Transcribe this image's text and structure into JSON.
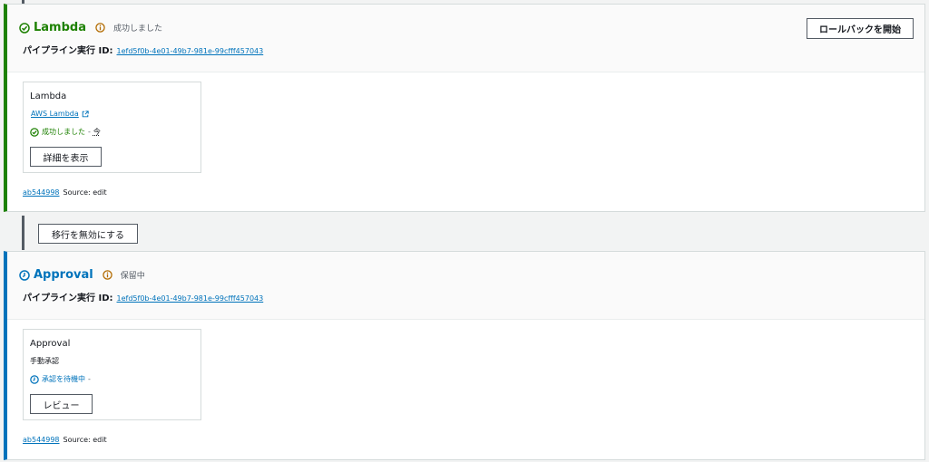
{
  "stages": [
    {
      "name": "Lambda",
      "status": "成功しました",
      "exec_label": "パイプライン実行 ID:",
      "exec_id": "1efd5f0b-4e01-49b7-981e-99cfff457043",
      "header_button": "ロールバックを開始",
      "action": {
        "name": "Lambda",
        "provider": "AWS Lambda",
        "status": "成功しました",
        "sep": "-",
        "time": "今",
        "button": "詳細を表示"
      },
      "commit": "ab544998",
      "source": "Source: edit",
      "color": "#1d8102"
    },
    {
      "name": "Approval",
      "status": "保留中",
      "exec_label": "パイプライン実行 ID:",
      "exec_id": "1efd5f0b-4e01-49b7-981e-99cfff457043",
      "action": {
        "name": "Approval",
        "provider": "手動承認",
        "status": "承認を待機中",
        "sep": "-",
        "button": "レビュー"
      },
      "commit": "ab544998",
      "source": "Source: edit",
      "color": "#0073bb"
    }
  ],
  "transition": {
    "button": "移行を無効にする"
  },
  "icons": [
    "check-circle-icon",
    "info-icon",
    "external-link-icon",
    "clock-icon"
  ]
}
